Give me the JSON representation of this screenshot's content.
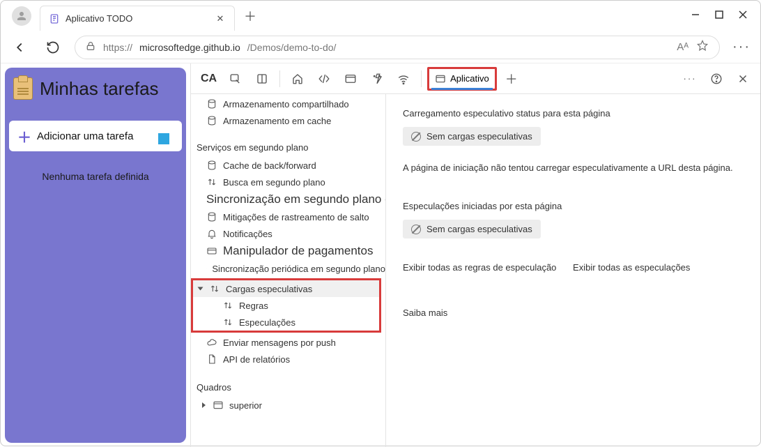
{
  "window": {
    "tab_title": "Aplicativo TODO"
  },
  "addressbar": {
    "url_prefix": "https://",
    "url_host": "microsoftedge.github.io",
    "url_path": "/Demos/demo-to-do/",
    "read_aloud": "Aᴬ"
  },
  "webapp": {
    "title": "Minhas tarefas",
    "add_placeholder": "Adicionar uma tarefa",
    "empty": "Nenhuma tarefa definida"
  },
  "devtools": {
    "locale_btn": "CA",
    "app_tab": "Aplicativo",
    "sidebar": {
      "storage_shared": "Armazenamento compartilhado",
      "storage_cache": "Armazenamento em cache",
      "bg_services_header": "Serviços em segundo plano",
      "bf_cache": "Cache de back/forward",
      "bg_fetch": "Busca em segundo plano",
      "bg_sync_cd": "Sincronização em segundo plano do CD",
      "bounce": "Mitigações de rastreamento de salto",
      "notifications": "Notificações",
      "payment": "Manipulador de pagamentos",
      "periodic_sync": "Sincronização periódica em segundo plano",
      "spec_loads": "Cargas especulativas",
      "rules": "Regras",
      "speculations": "Especulações",
      "push": "Enviar mensagens por push",
      "reports_api": "API de relatórios",
      "frames_header": "Quadros",
      "frame_top": "superior"
    },
    "content": {
      "h1": "Carregamento especulativo status para esta página",
      "pill1": "Sem cargas especulativas",
      "p1": "A página de iniciação não tentou carregar especulativamente a URL desta página.",
      "h2": "Especulações iniciadas por esta página",
      "pill2": "Sem cargas especulativas",
      "link1": "Exibir todas as regras de especulação",
      "link2": "Exibir todas as especulações",
      "learn": "Saiba mais"
    }
  }
}
